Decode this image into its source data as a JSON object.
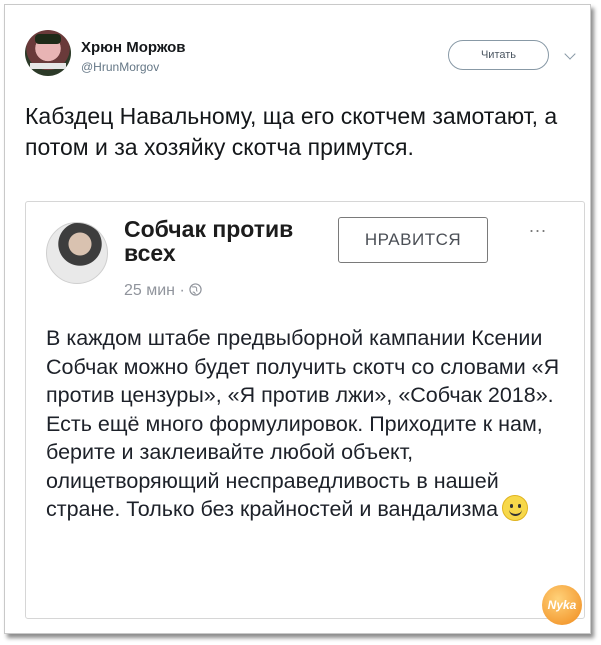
{
  "tweet": {
    "author_name": "Хрюн Моржов",
    "author_handle": "@HrunMorgov",
    "follow_label": "Читать",
    "text": "Кабздец Навальному, ща его скотчем замотают, а потом и за хозяйку скотча примутся."
  },
  "quoted_post": {
    "page_name": "Собчак против всех",
    "time": "25 мин",
    "separator": " · ",
    "like_label": "НРАВИТСЯ",
    "more_label": "...",
    "text": "В каждом штабе предвыборной кампании Ксении Собчак можно будет получить скотч со словами «Я против цензуры», «Я против лжи», «Собчак 2018». Есть ещё много формулировок. Приходите к нам, берите и заклеивайте любой объект, олицетворяющий несправедливость в нашей стране. Только без крайностей и вандализма"
  },
  "watermark": {
    "text": "Nyka"
  },
  "icons": {
    "dropdown": "chevron-down-icon",
    "globe": "globe-icon",
    "emoji": "smiley-icon"
  },
  "colors": {
    "secondary_text": "#657786",
    "fb_meta": "#90949c"
  }
}
